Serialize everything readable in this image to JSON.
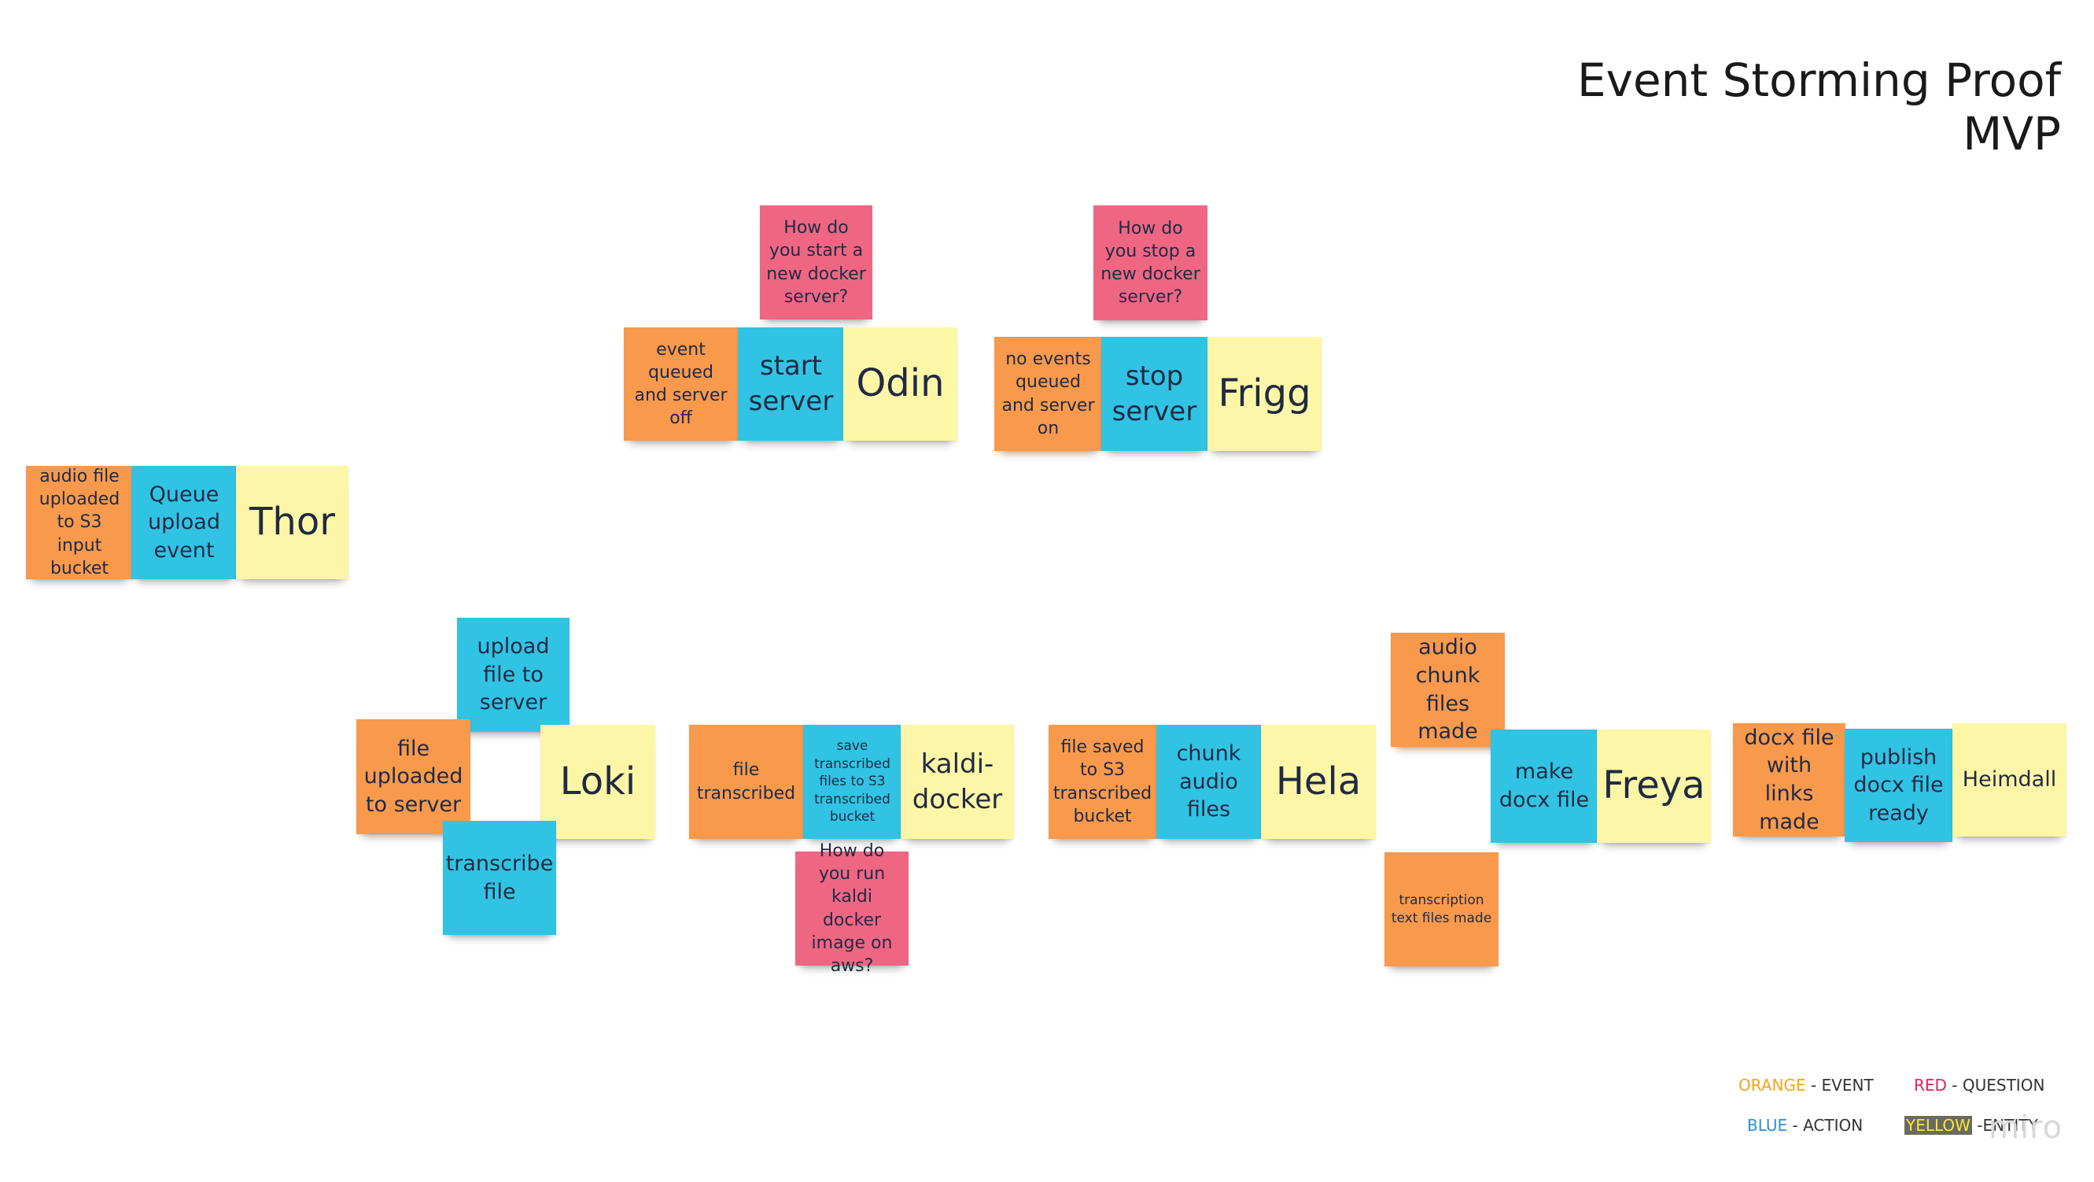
{
  "title": "Event Storming Proof MVP",
  "colors": {
    "orange": "#f8994c",
    "blue": "#31c3e3",
    "yellow": "#fdf6a6",
    "red": "#ef6683"
  },
  "notes": {
    "thor_event": "audio file uploaded to S3 input bucket",
    "thor_action": "Queue upload event",
    "thor_entity": "Thor",
    "odin_question": "How do you start a new docker server?",
    "odin_event": "event queued and server off",
    "odin_action": "start server",
    "odin_entity": "Odin",
    "frigg_question": "How do you stop a new docker server?",
    "frigg_event": "no events queued and server on",
    "frigg_action": "stop server",
    "frigg_entity": "Frigg",
    "loki_action_upload": "upload file to server",
    "loki_event": "file uploaded to server",
    "loki_entity": "Loki",
    "loki_action_transcribe": "transcribe file",
    "kaldi_event": "file transcribed",
    "kaldi_action": "save transcribed files to S3 transcribed bucket",
    "kaldi_entity": "kaldi-docker",
    "kaldi_question": "How do you run kaldi docker image on aws?",
    "hela_event": "file saved to S3 transcribed bucket",
    "hela_action": "chunk audio files",
    "hela_entity": "Hela",
    "freya_event_audio": "audio chunk files made",
    "freya_action": "make docx file",
    "freya_entity": "Freya",
    "freya_event_text": "transcription text files made",
    "heimdall_event": "docx file with links made",
    "heimdall_action": "publish docx file ready",
    "heimdall_entity": "Heimdall"
  },
  "legend": {
    "orange_word": "ORANGE",
    "orange_desc": " - EVENT",
    "red_word": "RED",
    "red_desc": " - QUESTION",
    "blue_word": "BLUE",
    "blue_desc": " - ACTION",
    "yellow_word": "YELLOW",
    "yellow_desc": " -ENTITY"
  },
  "watermark": "miro"
}
